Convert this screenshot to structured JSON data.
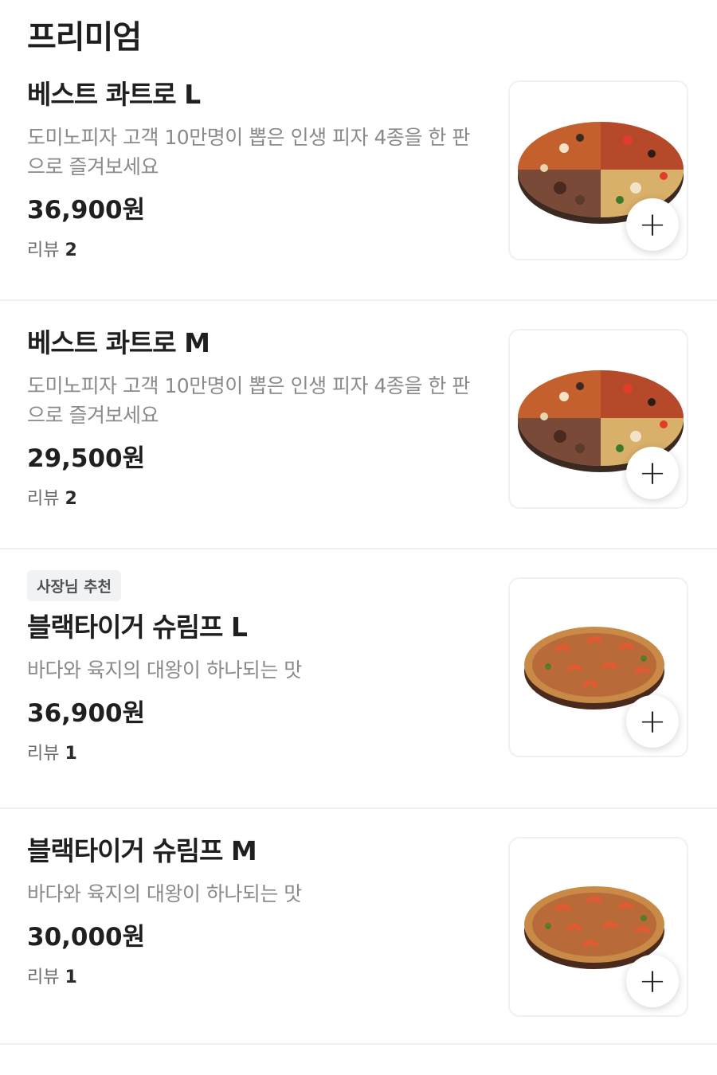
{
  "section": {
    "title": "프리미엄"
  },
  "items": [
    {
      "tag": "",
      "name": "베스트 콰트로 L",
      "desc": "도미노피자 고객 10만명이 뽑은 인생 피자 4종을 한 판으로 즐겨보세요",
      "price": "36,900원",
      "review_label": "리뷰",
      "review_count": "2",
      "pizza_style": "quattro",
      "add_icon": "+"
    },
    {
      "tag": "",
      "name": "베스트 콰트로 M",
      "desc": "도미노피자 고객 10만명이 뽑은 인생 피자 4종을 한 판으로 즐겨보세요",
      "price": "29,500원",
      "review_label": "리뷰",
      "review_count": "2",
      "pizza_style": "quattro",
      "add_icon": "+"
    },
    {
      "tag": "사장님 추천",
      "name": "블랙타이거 슈림프 L",
      "desc": "바다와 육지의 대왕이 하나되는 맛",
      "price": "36,900원",
      "review_label": "리뷰",
      "review_count": "1",
      "pizza_style": "shrimp",
      "add_icon": "+"
    },
    {
      "tag": "",
      "name": "블랙타이거 슈림프 M",
      "desc": "바다와 육지의 대왕이 하나되는 맛",
      "price": "30,000원",
      "review_label": "리뷰",
      "review_count": "1",
      "pizza_style": "shrimp",
      "add_icon": "+"
    }
  ],
  "colors": {
    "text_primary": "#1f1f1f",
    "text_secondary": "#8a8a8a",
    "divider": "#efefef",
    "tag_bg": "#f1f2f4"
  },
  "icons": {
    "add": "plus-icon",
    "pizza": "pizza-image"
  }
}
